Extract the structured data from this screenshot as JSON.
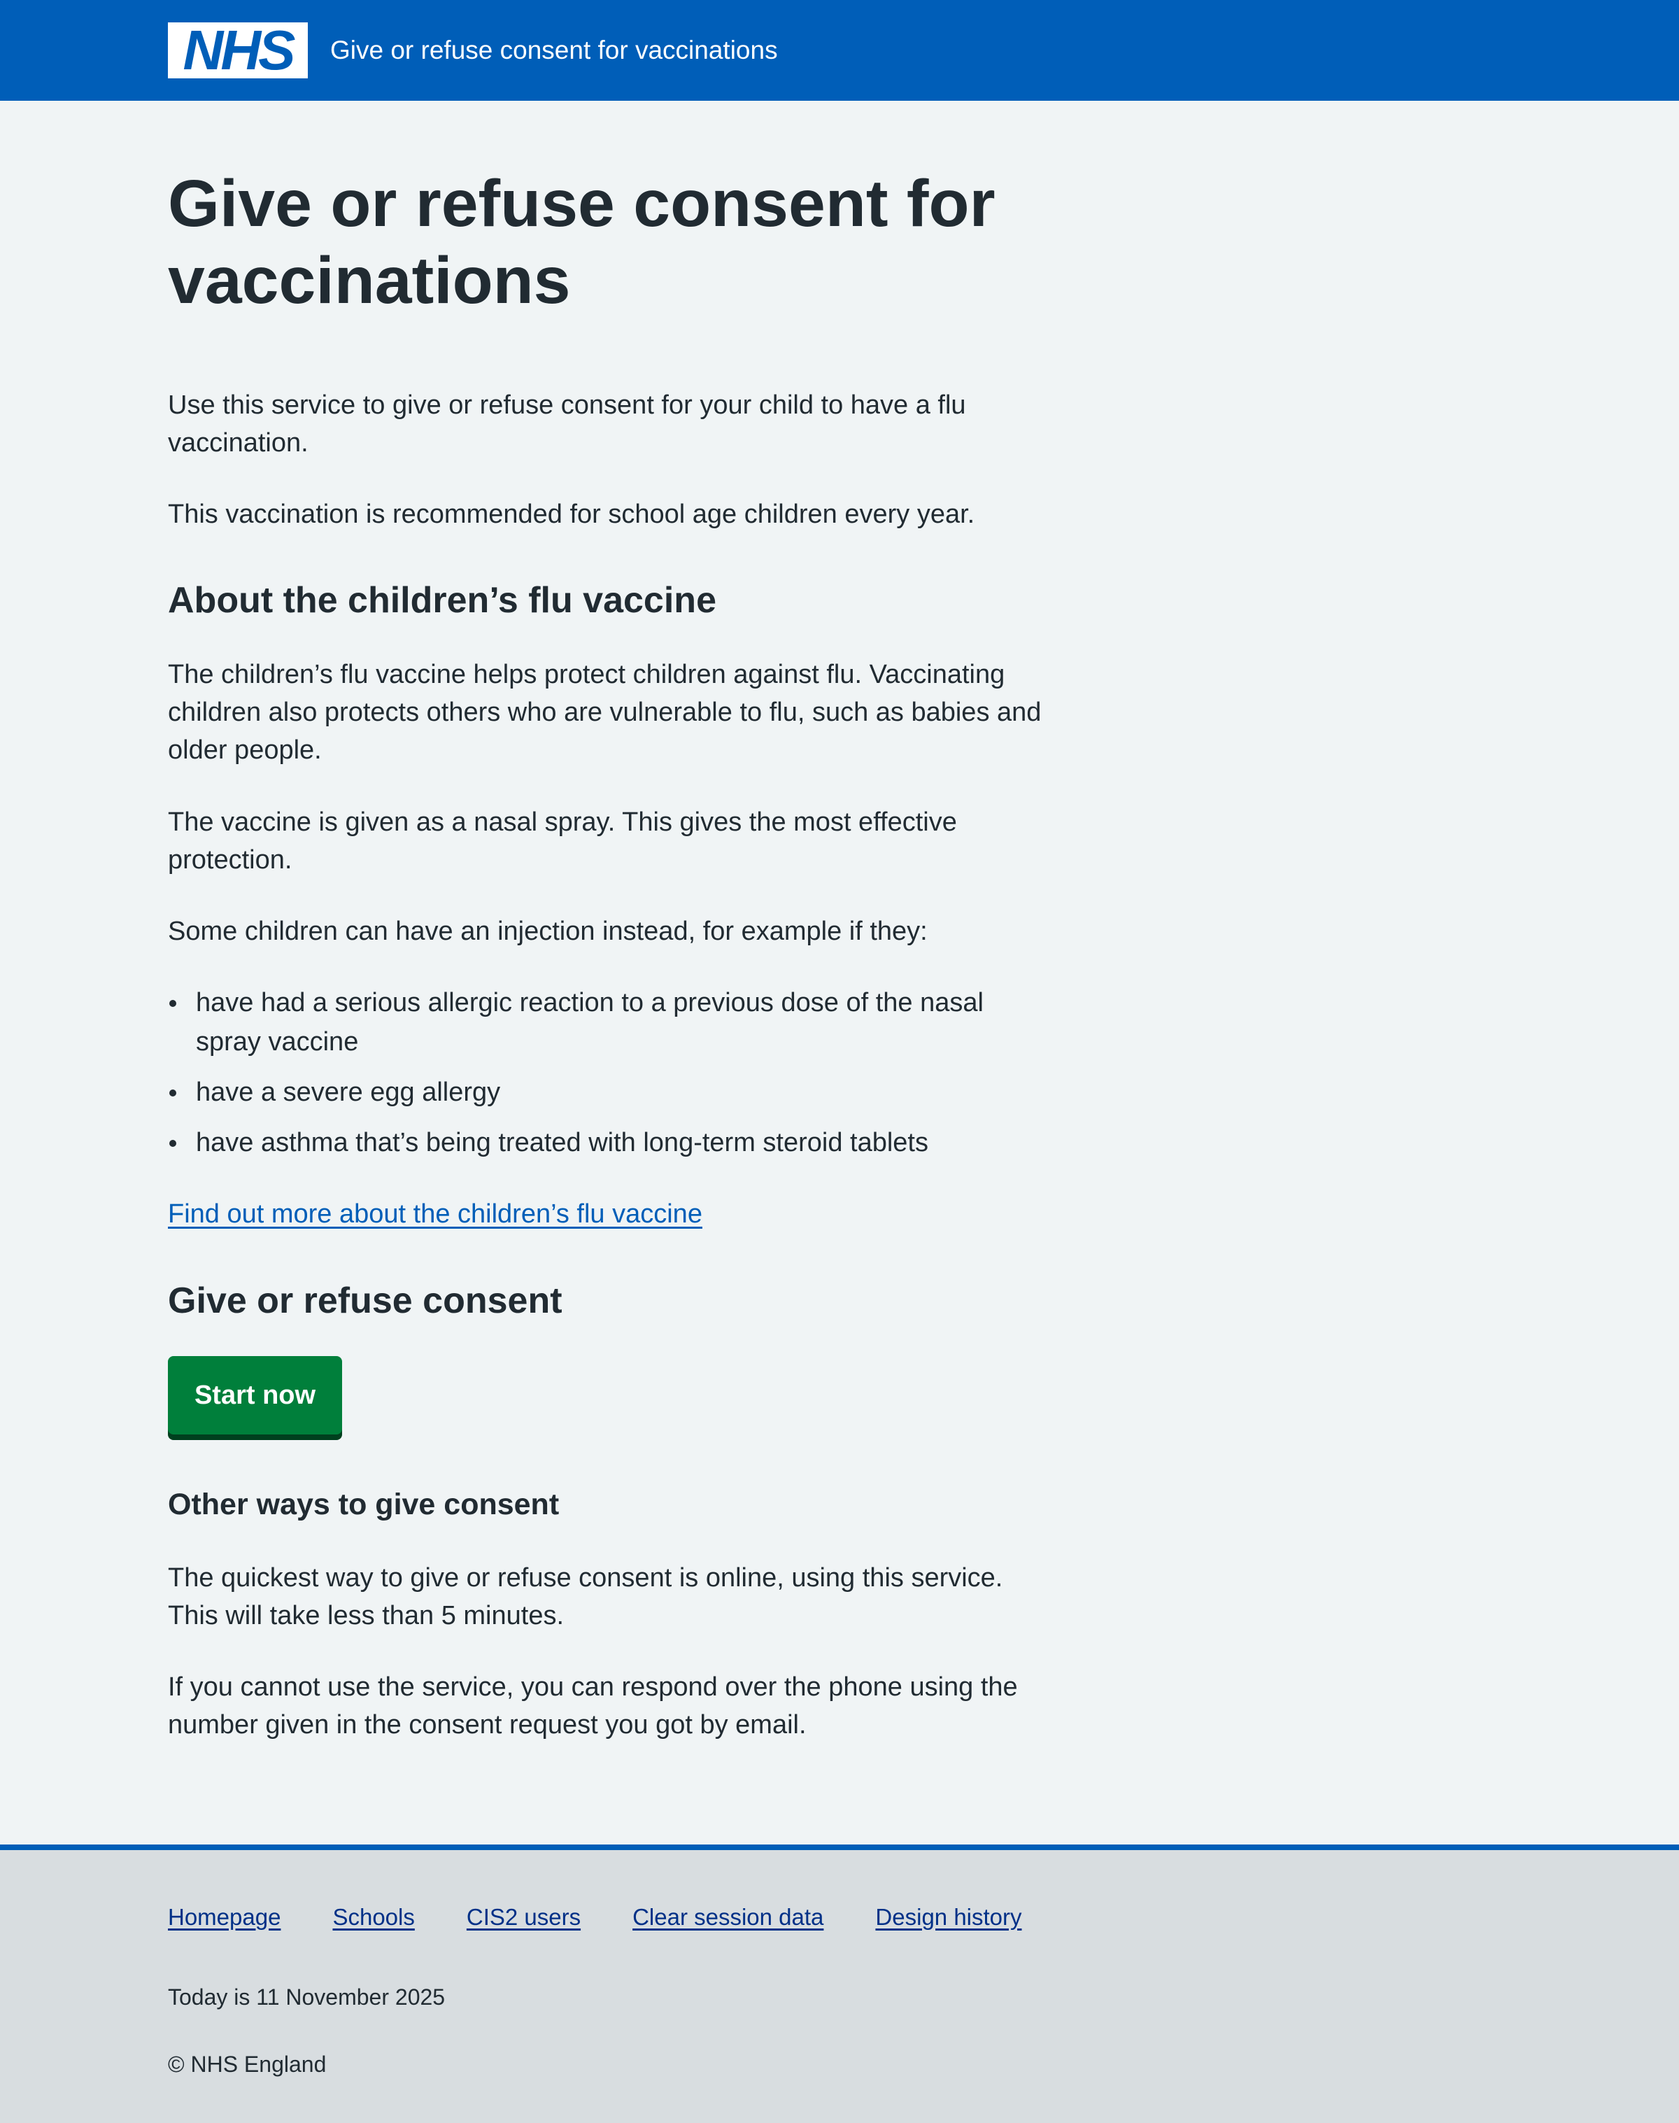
{
  "header": {
    "logo_text": "NHS",
    "service_name": "Give or refuse consent for vaccinations",
    "brand_color": "#005eb8"
  },
  "main": {
    "title": "Give or refuse consent for vaccinations",
    "intro": [
      "Use this service to give or refuse consent for your child to have a flu vaccination.",
      "This vaccination is recommended for school age children every year."
    ],
    "about_heading": "About the children’s flu vaccine",
    "about_paragraphs": [
      "The children’s flu vaccine helps protect children against flu. Vaccinating children also protects others who are vulnerable to flu, such as babies and older people.",
      "The vaccine is given as a nasal spray. This gives the most effective protection.",
      "Some children can have an injection instead, for example if they:"
    ],
    "bullets": [
      "have had a serious allergic reaction to a previous dose of the nasal spray vaccine",
      "have a severe egg allergy",
      "have asthma that’s being treated with long-term steroid tablets"
    ],
    "find_out_more_link": "Find out more about the children’s flu vaccine",
    "consent_heading": "Give or refuse consent",
    "start_button": "Start now",
    "start_button_color": "#007f3b",
    "other_ways_heading": "Other ways to give consent",
    "other_ways_paragraphs": [
      "The quickest way to give or refuse consent is online, using this service. This will take less than 5 minutes.",
      "If you cannot use the service, you can respond over the phone using the number given in the consent request you got by email."
    ]
  },
  "footer": {
    "links": [
      "Homepage",
      "Schools",
      "CIS2 users",
      "Clear session data",
      "Design history"
    ],
    "date_text": "Today is 11 November 2025",
    "copyright": "© NHS England"
  }
}
